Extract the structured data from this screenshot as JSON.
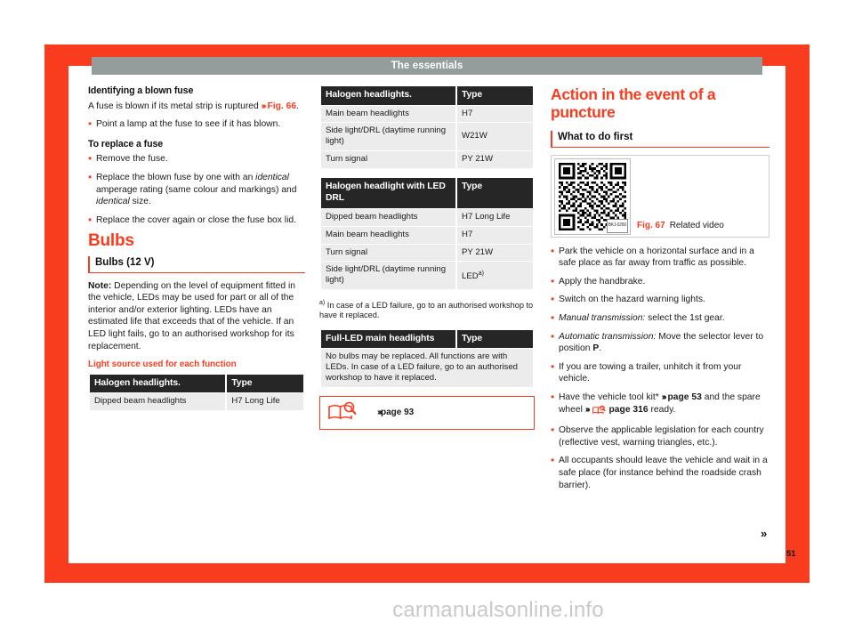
{
  "header": {
    "title": "The essentials"
  },
  "colors": {
    "accent": "#fa3c1e",
    "header_bar": "#939d9b",
    "table_header_bg": "#262626",
    "table_cell_bg": "#ececec",
    "watermark": "#c9c9c9"
  },
  "left_column": {
    "heading_1": "Identifying a blown fuse",
    "para_1_before": "A fuse is blown if its metal strip is ruptured ",
    "para_1_chevrons": "›››",
    "para_1_link": "Fig. 66",
    "para_1_after": ".",
    "bullet_1": "Point a lamp at the fuse to see if it has blown.",
    "heading_2": "To replace a fuse",
    "bullet_2": "Remove the fuse.",
    "bullet_3_part1": "Replace the blown fuse by one with an ",
    "bullet_3_ital1": "identical",
    "bullet_3_part2": " amperage rating (same colour and markings) and ",
    "bullet_3_ital2": "identical",
    "bullet_3_part3": " size.",
    "bullet_4": "Replace the cover again or close the fuse box lid.",
    "section_title": "Bulbs",
    "sub_heading": "Bulbs (12 V)",
    "note_label": "Note:",
    "note_text": " Depending on the level of equipment fitted in the vehicle, LEDs may be used for part or all of the interior and/or exterior lighting. LEDs have an estimated life that exceeds that of the vehicle. If an LED light fails, go to an authorised workshop for its replacement.",
    "table_label": "Light source used for each function",
    "table": {
      "headers": [
        "Halogen headlights.",
        "Type"
      ],
      "rows": [
        [
          "Dipped beam headlights",
          "H7 Long Life"
        ]
      ]
    }
  },
  "middle_column": {
    "table_1": {
      "headers": [
        "Halogen headlights.",
        "Type"
      ],
      "rows": [
        [
          "Main beam headlights",
          "H7"
        ],
        [
          "Side light/DRL (daytime running light)",
          "W21W"
        ],
        [
          "Turn signal",
          "PY 21W"
        ]
      ]
    },
    "table_2": {
      "headers": [
        "Halogen headlight with LED DRL",
        "Type"
      ],
      "rows": [
        [
          "Dipped beam headlights",
          "H7 Long Life"
        ],
        [
          "Main beam headlights",
          "H7"
        ],
        [
          "Turn signal",
          "PY 21W"
        ],
        [
          "Side light/DRL (daytime running light)",
          "LED"
        ]
      ],
      "footnote_marker": "a)",
      "footnote_text": "In case of a LED failure, go to an authorised workshop to have it replaced."
    },
    "table_3": {
      "headers": [
        "Full-LED main headlights",
        "Type"
      ],
      "rows": [
        [
          "No bulbs may be replaced. All functions are with LEDs. In case of a LED failure, go to an authorised workshop to have it replaced."
        ]
      ]
    },
    "ref_box": {
      "icon": "book-magnifier-icon",
      "chevrons": "›››",
      "text": "page 93"
    }
  },
  "right_column": {
    "title": "Action in the event of a puncture",
    "sub_heading": "What to do first",
    "figure": {
      "qr_label": "BKJ-0260",
      "caption_number": "Fig. 67",
      "caption_text": "Related video"
    },
    "bullets": [
      {
        "text": "Park the vehicle on a horizontal surface and in a safe place as far away from traffic as possible."
      },
      {
        "text": "Apply the handbrake."
      },
      {
        "text": "Switch on the hazard warning lights."
      },
      {
        "italic_lead": "Manual transmission:",
        "text": " select the 1st gear."
      },
      {
        "italic_lead": "Automatic transmission:",
        "text": " Move the selector lever to position ",
        "bold_tail": "P",
        "tail": "."
      },
      {
        "text": "If you are towing a trailer, unhitch it from your vehicle."
      },
      {
        "text_a": "Have the vehicle tool kit* ",
        "chev1": "›››",
        "link1": "page 53",
        "text_b": " and the spare wheel ",
        "chev2": "›››",
        "icon": "book-magnifier-icon",
        "link2": "page 316",
        "text_c": " ready."
      },
      {
        "text": "Observe the applicable legislation for each country (reflective vest, warning triangles, etc.)."
      },
      {
        "text": "All occupants should leave the vehicle and wait in a safe place (for instance behind the roadside crash barrier)."
      }
    ]
  },
  "footer": {
    "continuation_marker": "»",
    "page_number": "51",
    "watermark": "carmanualsonline.info"
  }
}
